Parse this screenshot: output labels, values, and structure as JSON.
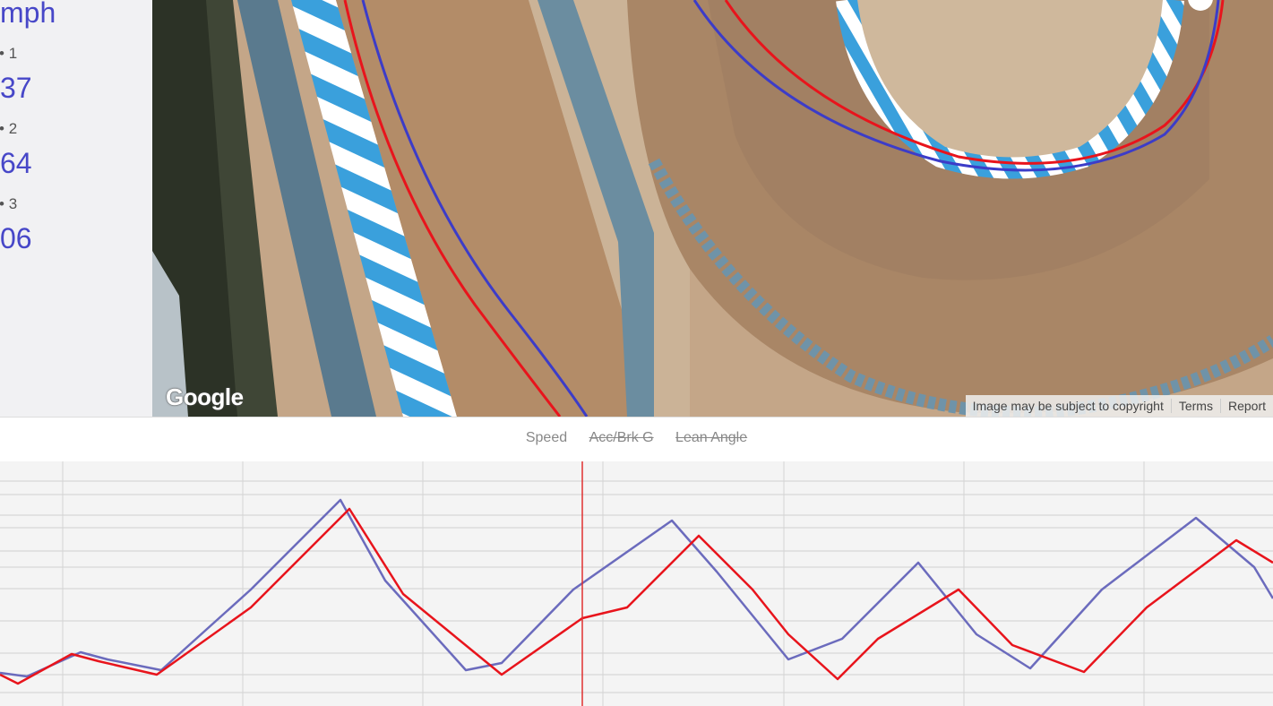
{
  "sidebar": {
    "speed_unit": "mph",
    "sectors": [
      {
        "label": "1",
        "value": "37"
      },
      {
        "label": "2",
        "value": "64"
      },
      {
        "label": "3",
        "value": "06"
      }
    ]
  },
  "map": {
    "logo": "Google",
    "attribution": [
      "Image may be subject to copyright",
      "Terms",
      "Report"
    ]
  },
  "chart": {
    "legend": [
      {
        "label": "Speed",
        "active": true
      },
      {
        "label": "Acc/Brk G",
        "active": false
      },
      {
        "label": "Lean Angle",
        "active": false
      }
    ]
  },
  "colors": {
    "lap_a": "#e8141c",
    "lap_b": "#6b6bbd",
    "cursor": "#e03030",
    "accent": "#4747c8"
  },
  "chart_data": {
    "type": "line",
    "title": "",
    "xlabel": "",
    "ylabel": "",
    "grid": true,
    "series": [
      {
        "color": "#6b6bbd",
        "x": [
          0,
          30,
          90,
          120,
          180,
          280,
          380,
          430,
          520,
          560,
          640,
          750,
          800,
          880,
          940,
          1025,
          1090,
          1150,
          1230,
          1335,
          1400,
          1421
        ],
        "y": [
          37,
          33,
          60,
          52,
          40,
          130,
          230,
          140,
          40,
          48,
          130,
          207,
          150,
          52,
          75,
          160,
          80,
          42,
          130,
          210,
          155,
          120
        ]
      },
      {
        "color": "#e8141c",
        "x": [
          0,
          20,
          80,
          110,
          175,
          280,
          390,
          450,
          560,
          650,
          700,
          780,
          840,
          880,
          935,
          980,
          1070,
          1130,
          1210,
          1280,
          1380,
          1421
        ],
        "y": [
          35,
          25,
          58,
          50,
          35,
          110,
          220,
          125,
          35,
          98,
          110,
          190,
          130,
          80,
          30,
          75,
          130,
          68,
          38,
          110,
          185,
          160
        ]
      }
    ],
    "xlim": [
      0,
      1421
    ],
    "ylim": [
      0,
      273
    ],
    "cursor_x": 650
  }
}
